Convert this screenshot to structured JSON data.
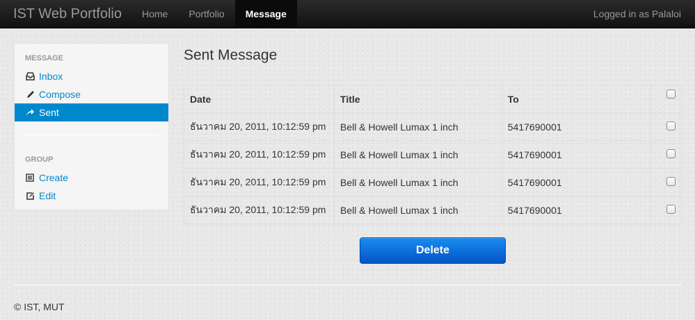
{
  "navbar": {
    "brand": "IST Web Portfolio",
    "items": [
      {
        "label": "Home"
      },
      {
        "label": "Portfolio"
      },
      {
        "label": "Message"
      }
    ],
    "login_text": "Logged in as Palaloi"
  },
  "sidebar": {
    "message_header": "MESSAGE",
    "message_items": [
      {
        "label": "Inbox",
        "icon": "inbox-icon"
      },
      {
        "label": "Compose",
        "icon": "pencil-icon"
      },
      {
        "label": "Sent",
        "icon": "share-arrow-icon"
      }
    ],
    "group_header": "GROUP",
    "group_items": [
      {
        "label": "Create",
        "icon": "list-icon"
      },
      {
        "label": "Edit",
        "icon": "edit-icon"
      }
    ]
  },
  "main": {
    "title": "Sent Message",
    "table": {
      "headers": {
        "date": "Date",
        "title": "Title",
        "to": "To"
      },
      "rows": [
        {
          "date": "ธันวาคม 20, 2011, 10:12:59 pm",
          "title": "Bell & Howell Lumax 1 inch",
          "to": "5417690001"
        },
        {
          "date": "ธันวาคม 20, 2011, 10:12:59 pm",
          "title": "Bell & Howell Lumax 1 inch",
          "to": "5417690001"
        },
        {
          "date": "ธันวาคม 20, 2011, 10:12:59 pm",
          "title": "Bell & Howell Lumax 1 inch",
          "to": "5417690001"
        },
        {
          "date": "ธันวาคม 20, 2011, 10:12:59 pm",
          "title": "Bell & Howell Lumax 1 inch",
          "to": "5417690001"
        }
      ]
    },
    "delete_label": "Delete"
  },
  "footer": {
    "text": "© IST, MUT"
  },
  "colors": {
    "accent": "#0088cc",
    "button": "#0a6fdc",
    "navbar": "#1b1b1b"
  }
}
